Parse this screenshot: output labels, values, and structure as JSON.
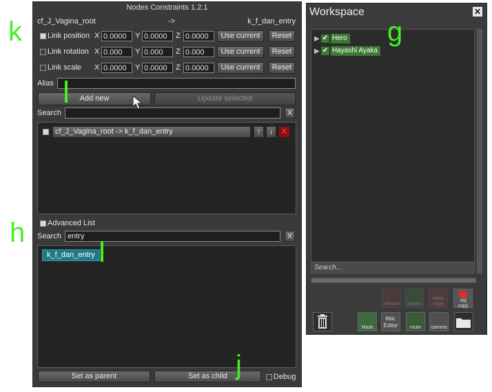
{
  "nodes_constraints": {
    "title": "Nodes Constraints 1.2.1",
    "parent_node": "cf_J_Vagina_root",
    "arrow": "->",
    "child_node": "k_f_dan_entry",
    "rows": [
      {
        "label": "Link position",
        "checked": true,
        "x": "0.0000",
        "y": "0.0000",
        "z": "0.0000"
      },
      {
        "label": "Link rotation",
        "checked": false,
        "x": "0.000",
        "y": "0.000",
        "z": "0.000"
      },
      {
        "label": "Link scale",
        "checked": false,
        "x": "0.0000",
        "y": "0.0000",
        "z": "0.0000"
      }
    ],
    "axis_x": "X",
    "axis_y": "Y",
    "axis_z": "Z",
    "use_current_label": "Use current",
    "reset_label": "Reset",
    "alias_label": "Alias",
    "alias_value": "",
    "add_new_label": "Add new",
    "update_selected_label": "Update selected",
    "search_label": "Search",
    "search_value": "",
    "clear_label": "X",
    "constraints": [
      {
        "text": "cf_J_Vagina_root -> k_f_dan_entry",
        "up": "↑",
        "down": "↓",
        "delete": "X"
      }
    ],
    "advanced_list_label": "Advanced List",
    "advanced_list_checked": true,
    "search2_label": "Search",
    "search2_value": "entry",
    "results": [
      "k_f_dan_entry"
    ],
    "set_as_parent_label": "Set as parent",
    "set_as_child_label": "Set as child",
    "debug_label": "Debug"
  },
  "workspace": {
    "title": "Workspace",
    "close": "✕",
    "tree": [
      {
        "label": "Hero",
        "checked": true
      },
      {
        "label": "Hayashi Ayaka",
        "checked": true
      }
    ],
    "search_placeholder": "Search...",
    "tools_row1": [
      "release",
      "parent",
      "move copy",
      "obj copy"
    ],
    "tools_row2": [
      "Mask",
      "Mat. Editor",
      "route",
      "camera"
    ]
  },
  "overlay_labels": {
    "k": "k",
    "g": "g",
    "h": "h",
    "j": "j"
  },
  "colors": {
    "overlay_green": "#44ee22",
    "tree_item_bg": "#3e7a34",
    "result_item_bg": "#1f7a86"
  }
}
